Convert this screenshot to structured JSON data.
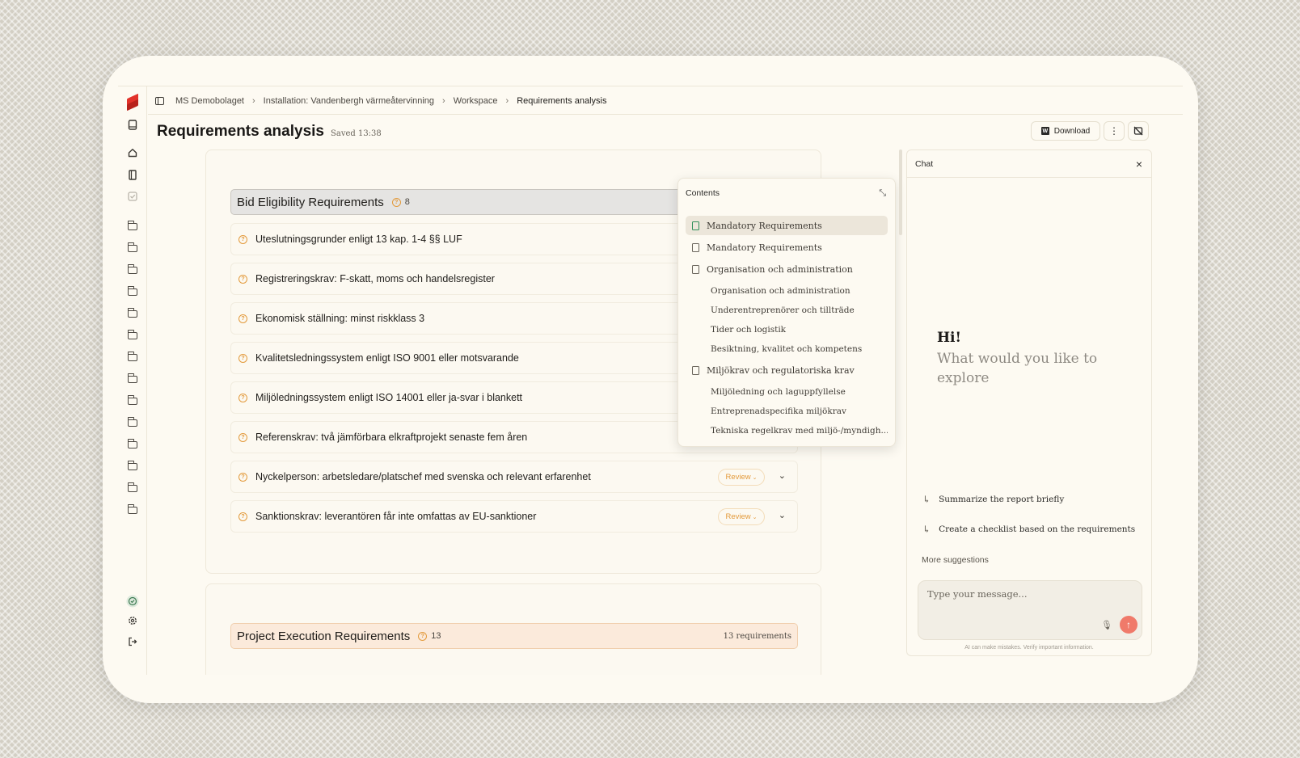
{
  "app": {
    "breadcrumbs": [
      "MS Demobolaget",
      "Installation: Vandenbergh värmeåtervinning",
      "Workspace",
      "Requirements analysis"
    ],
    "title": "Requirements analysis",
    "saved": "Saved 13:38",
    "download_label": "Download",
    "brand_color": "#e2322a"
  },
  "sections": [
    {
      "title": "Bid Eligibility Requirements",
      "count": "8",
      "requirements": [
        {
          "text": "Uteslutningsgrunder enligt 13 kap. 1-4 §§ LUF"
        },
        {
          "text": "Registreringskrav: F-skatt, moms och handelsregister"
        },
        {
          "text": "Ekonomisk ställning: minst riskklass 3"
        },
        {
          "text": "Kvalitetsledningssystem enligt ISO 9001 eller motsvarande"
        },
        {
          "text": "Miljöledningssystem enligt ISO 14001 eller ja-svar i blankett"
        },
        {
          "text": "Referenskrav: två jämförbara elkraftprojekt senaste fem åren"
        },
        {
          "text": "Nyckelperson: arbetsledare/platschef med svenska och relevant erfarenhet",
          "status": "Review"
        },
        {
          "text": "Sanktionskrav: leverantören får inte omfattas av EU-sanktioner",
          "status": "Review"
        }
      ]
    },
    {
      "title": "Project Execution Requirements",
      "count": "13",
      "meta": "13 requirements"
    }
  ],
  "contents": {
    "title": "Contents",
    "items": [
      {
        "label": "Mandatory Requirements",
        "level": 0,
        "active": true
      },
      {
        "label": "Mandatory Requirements",
        "level": 0
      },
      {
        "label": "Organisation och administration",
        "level": 0
      },
      {
        "label": "Organisation och administration",
        "level": 1
      },
      {
        "label": "Underentreprenörer och tillträde",
        "level": 1
      },
      {
        "label": "Tider och logistik",
        "level": 1
      },
      {
        "label": "Besiktning, kvalitet och kompetens",
        "level": 1
      },
      {
        "label": "Miljökrav och regulatoriska krav",
        "level": 0
      },
      {
        "label": "Miljöledning och laguppfyllelse",
        "level": 1
      },
      {
        "label": "Entreprenadspecifika miljökrav",
        "level": 1
      },
      {
        "label": "Tekniska regelkrav med miljö-/myndigh...",
        "level": 1
      }
    ]
  },
  "chat": {
    "title": "Chat",
    "greeting": "Hi!",
    "prompt": "What would you like to explore",
    "suggestions": [
      "Summarize the report briefly",
      "Create a checklist based on the requirements"
    ],
    "more": "More suggestions",
    "placeholder": "Type your message...",
    "disclaimer": "AI can make mistakes. Verify important information.",
    "send_color": "#f07a6a"
  },
  "icons": {
    "rail_top": [
      "logo-icon",
      "book-icon",
      "home-icon",
      "book-open-icon",
      "checkbox-icon"
    ],
    "rail_folders": 14,
    "rail_bottom": [
      "check-circle-icon",
      "gear-icon",
      "logout-icon"
    ]
  }
}
